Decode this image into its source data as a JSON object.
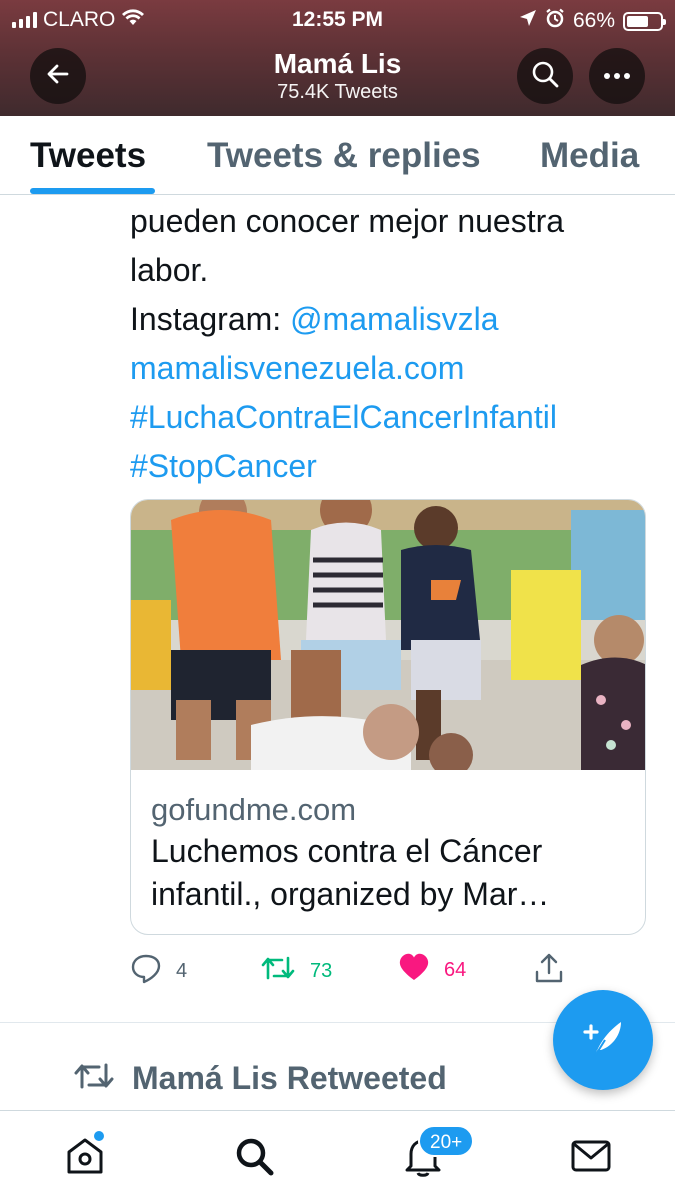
{
  "status_bar": {
    "carrier": "CLARO",
    "time": "12:55 PM",
    "battery_percent": "66%",
    "battery_level": 0.66,
    "icons": [
      "signal-icon",
      "wifi-icon",
      "location-arrow-icon",
      "alarm-icon",
      "battery-icon"
    ]
  },
  "profile": {
    "name": "Mamá Lis",
    "tweet_count": "75.4K Tweets"
  },
  "tabs": [
    {
      "label": "Tweets",
      "active": true
    },
    {
      "label": "Tweets & replies",
      "active": false
    },
    {
      "label": "Media",
      "active": false
    }
  ],
  "tweet": {
    "text_line1": "pueden conocer mejor nuestra",
    "text_line2": "labor.",
    "instagram_label": "Instagram: ",
    "instagram_handle": "@mamalisvzla",
    "website": "mamalisvenezuela.com",
    "hashtag1": "#LuchaContraElCancerInfantil",
    "hashtag2": "#StopCancer",
    "card": {
      "domain": "gofundme.com",
      "title_line1": "Luchemos contra el Cáncer",
      "title_line2": "infantil., organized by Mar…"
    },
    "actions": {
      "replies": "4",
      "retweets": "73",
      "likes": "64"
    }
  },
  "next_item": {
    "retweet_label": "Mamá Lis Retweeted"
  },
  "bottom_nav": {
    "notifications_badge": "20+"
  },
  "colors": {
    "accent": "#1d9bf0",
    "retweet": "#00ba7c",
    "like": "#f91880",
    "secondary_text": "#536471"
  }
}
